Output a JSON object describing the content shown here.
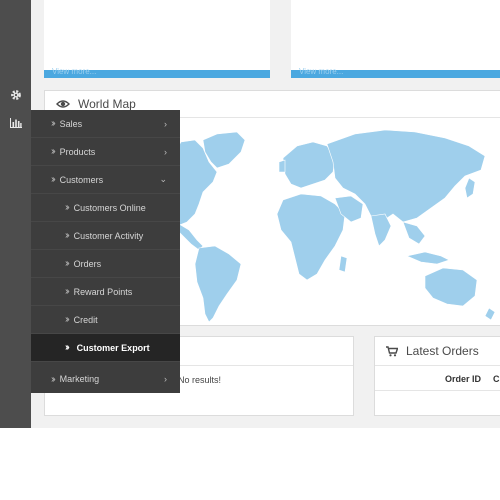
{
  "tiles": {
    "left_link": "View more...",
    "right_link": "View more..."
  },
  "sidebar": {
    "rail_icons": [
      "gear-icon",
      "bar-chart-icon"
    ],
    "menu": [
      {
        "label": "Sales",
        "indicator": "›"
      },
      {
        "label": "Products",
        "indicator": "›"
      },
      {
        "label": "Customers",
        "indicator": "⌄"
      },
      {
        "label": "Customers Online",
        "indicator": ""
      },
      {
        "label": "Customer Activity",
        "indicator": ""
      },
      {
        "label": "Orders",
        "indicator": ""
      },
      {
        "label": "Reward Points",
        "indicator": ""
      },
      {
        "label": "Credit",
        "indicator": ""
      },
      {
        "label": "Customer Export",
        "indicator": ""
      },
      {
        "label": "Marketing",
        "indicator": "›"
      }
    ]
  },
  "world_map": {
    "title": "World Map",
    "icon": "eye-icon"
  },
  "left_panel": {
    "empty_text": "No results!"
  },
  "latest_orders": {
    "title": "Latest Orders",
    "icon": "cart-icon",
    "columns": [
      "Order ID",
      "Cu"
    ]
  },
  "colors": {
    "map_land": "#9fcfec",
    "accent": "#4ba8e0",
    "menu_bg": "#3d3d3d",
    "rail_bg": "#4d4d4d"
  }
}
